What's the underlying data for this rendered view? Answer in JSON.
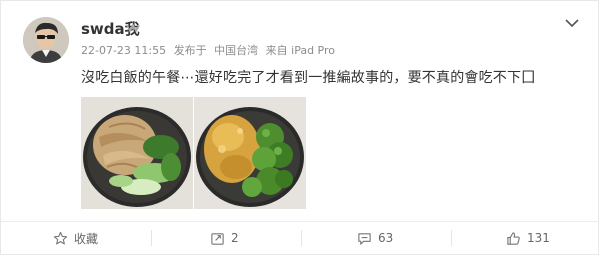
{
  "post": {
    "username": "swda我",
    "date": "22-07-23 11:55",
    "source_label": "发布于",
    "location": "中国台湾",
    "device": "来自 iPad Pro",
    "text": "沒吃白飯的午餐⋯還好吃完了才看到一推編故事的，要不真的會吃不下囗"
  },
  "actions": {
    "favorite_label": "收藏",
    "repost_count": "2",
    "comment_count": "63",
    "like_count": "131"
  },
  "icons": {
    "vip": "vip-badge-icon",
    "menu": "chevron-down-icon",
    "favorite": "star-icon",
    "repost": "repost-icon",
    "comment": "comment-icon",
    "like": "thumbs-up-icon"
  },
  "colors": {
    "text": "#333333",
    "meta": "#8c8c8c",
    "action": "#666666"
  }
}
